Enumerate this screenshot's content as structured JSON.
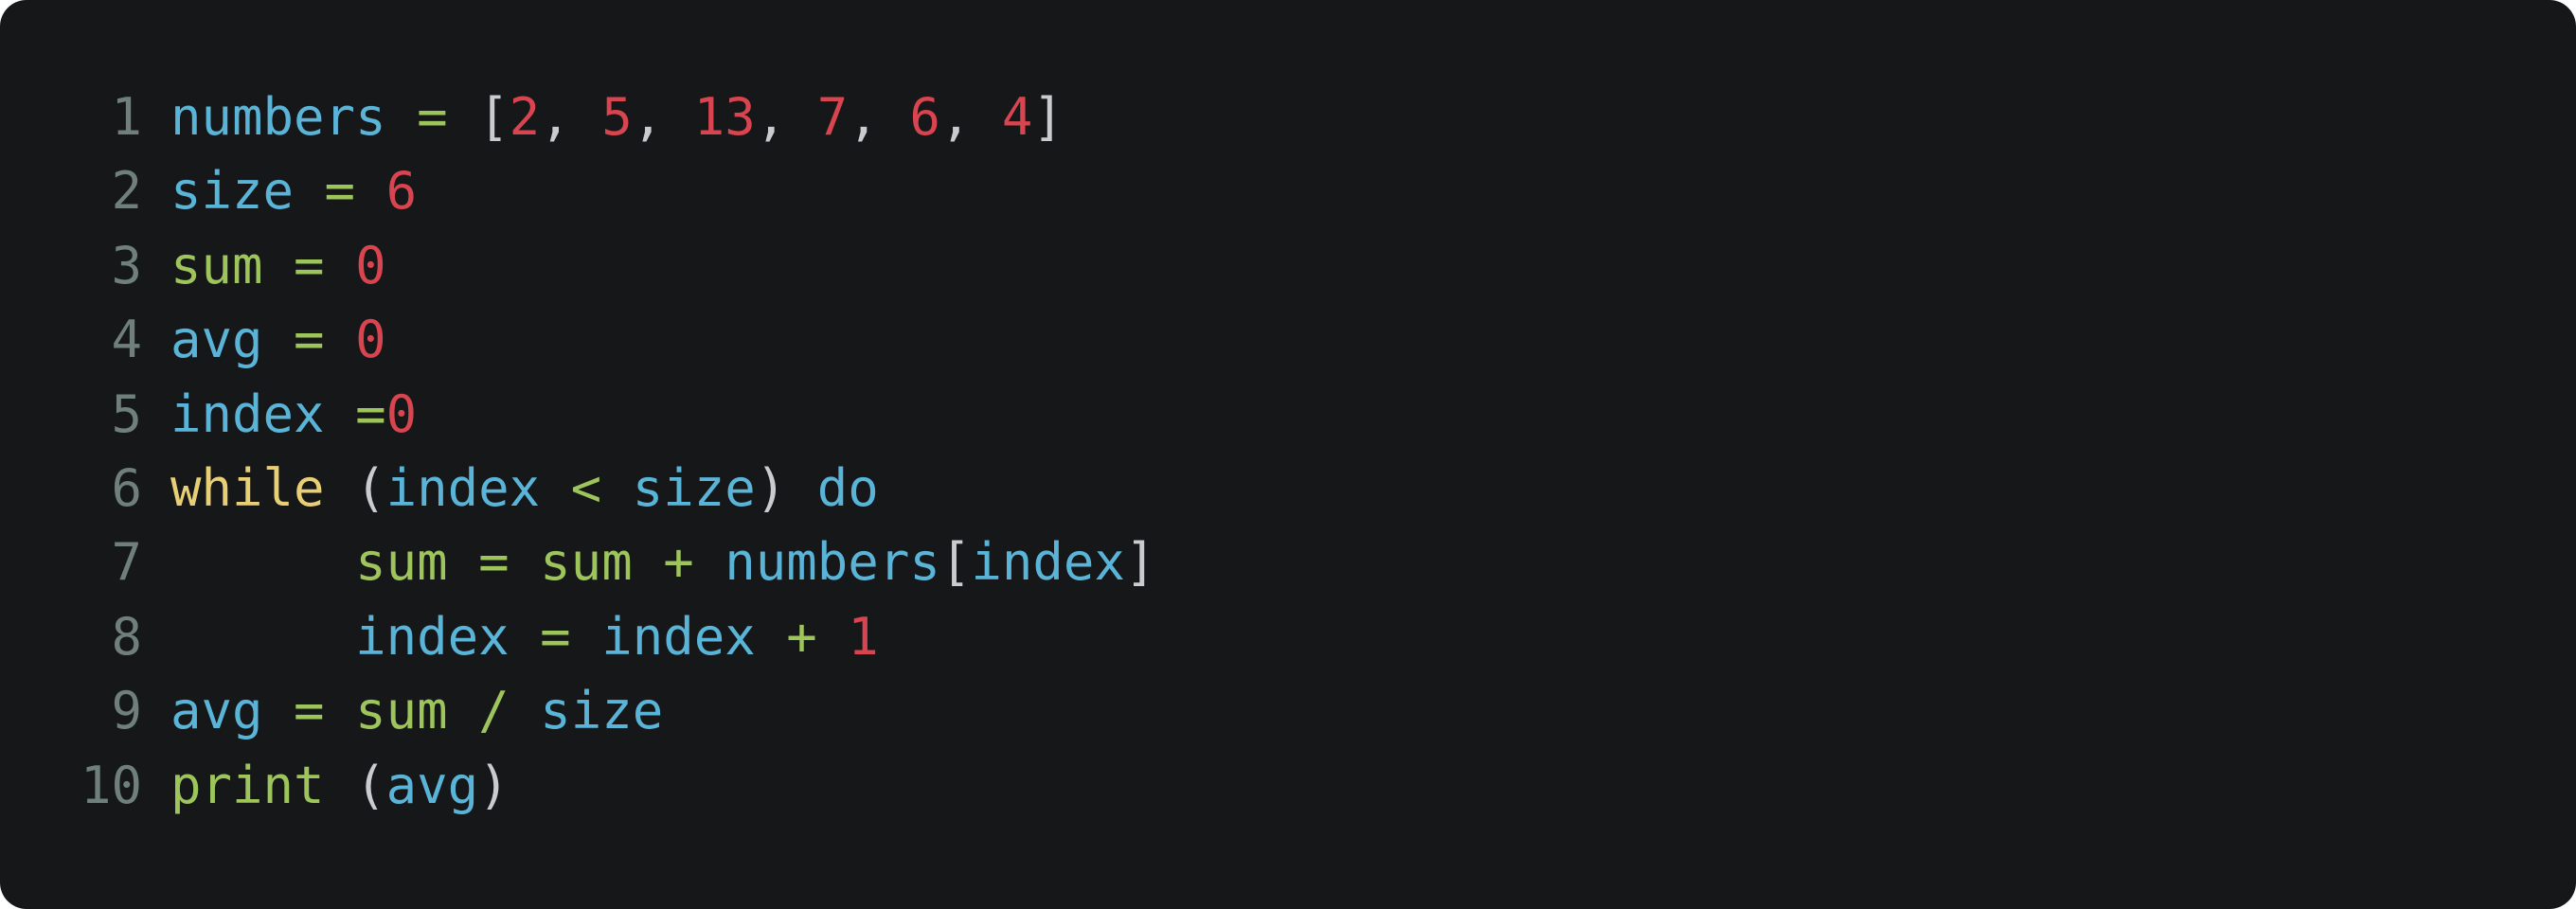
{
  "colors": {
    "background": "#151719",
    "line_number": "#6f7f7a",
    "identifier_blue": "#5ab4d8",
    "identifier_green": "#9ec45c",
    "number_red": "#d8444f",
    "keyword_yellow": "#e8cf76",
    "punctuation": "#c9cccf"
  },
  "lines": [
    {
      "number": "1",
      "tokens": [
        {
          "text": "numbers",
          "color": "#5ab4d8"
        },
        {
          "text": " = ",
          "color": "#9ec45c"
        },
        {
          "text": "[",
          "color": "#c9cccf"
        },
        {
          "text": "2",
          "color": "#d8444f"
        },
        {
          "text": ", ",
          "color": "#c9cccf"
        },
        {
          "text": "5",
          "color": "#d8444f"
        },
        {
          "text": ", ",
          "color": "#c9cccf"
        },
        {
          "text": "13",
          "color": "#d8444f"
        },
        {
          "text": ", ",
          "color": "#c9cccf"
        },
        {
          "text": "7",
          "color": "#d8444f"
        },
        {
          "text": ", ",
          "color": "#c9cccf"
        },
        {
          "text": "6",
          "color": "#d8444f"
        },
        {
          "text": ", ",
          "color": "#c9cccf"
        },
        {
          "text": "4",
          "color": "#d8444f"
        },
        {
          "text": "]",
          "color": "#c9cccf"
        }
      ]
    },
    {
      "number": "2",
      "tokens": [
        {
          "text": "size",
          "color": "#5ab4d8"
        },
        {
          "text": " = ",
          "color": "#9ec45c"
        },
        {
          "text": "6",
          "color": "#d8444f"
        }
      ]
    },
    {
      "number": "3",
      "tokens": [
        {
          "text": "sum",
          "color": "#9ec45c"
        },
        {
          "text": " = ",
          "color": "#9ec45c"
        },
        {
          "text": "0",
          "color": "#d8444f"
        }
      ]
    },
    {
      "number": "4",
      "tokens": [
        {
          "text": "avg",
          "color": "#5ab4d8"
        },
        {
          "text": " = ",
          "color": "#9ec45c"
        },
        {
          "text": "0",
          "color": "#d8444f"
        }
      ]
    },
    {
      "number": "5",
      "tokens": [
        {
          "text": "index",
          "color": "#5ab4d8"
        },
        {
          "text": " =",
          "color": "#9ec45c"
        },
        {
          "text": "0",
          "color": "#d8444f"
        }
      ]
    },
    {
      "number": "6",
      "tokens": [
        {
          "text": "while",
          "color": "#e8cf76"
        },
        {
          "text": " (",
          "color": "#c9cccf"
        },
        {
          "text": "index",
          "color": "#5ab4d8"
        },
        {
          "text": " < ",
          "color": "#9ec45c"
        },
        {
          "text": "size",
          "color": "#5ab4d8"
        },
        {
          "text": ") ",
          "color": "#c9cccf"
        },
        {
          "text": "do",
          "color": "#5ab4d8"
        }
      ]
    },
    {
      "number": "7",
      "tokens": [
        {
          "text": "      ",
          "color": "#c9cccf"
        },
        {
          "text": "sum",
          "color": "#9ec45c"
        },
        {
          "text": " = ",
          "color": "#9ec45c"
        },
        {
          "text": "sum",
          "color": "#9ec45c"
        },
        {
          "text": " + ",
          "color": "#9ec45c"
        },
        {
          "text": "numbers",
          "color": "#5ab4d8"
        },
        {
          "text": "[",
          "color": "#c9cccf"
        },
        {
          "text": "index",
          "color": "#5ab4d8"
        },
        {
          "text": "]",
          "color": "#c9cccf"
        }
      ]
    },
    {
      "number": "8",
      "tokens": [
        {
          "text": "      ",
          "color": "#c9cccf"
        },
        {
          "text": "index",
          "color": "#5ab4d8"
        },
        {
          "text": " = ",
          "color": "#9ec45c"
        },
        {
          "text": "index",
          "color": "#5ab4d8"
        },
        {
          "text": " + ",
          "color": "#9ec45c"
        },
        {
          "text": "1",
          "color": "#d8444f"
        }
      ]
    },
    {
      "number": "9",
      "tokens": [
        {
          "text": "avg",
          "color": "#5ab4d8"
        },
        {
          "text": " = ",
          "color": "#9ec45c"
        },
        {
          "text": "sum",
          "color": "#9ec45c"
        },
        {
          "text": " / ",
          "color": "#9ec45c"
        },
        {
          "text": "size",
          "color": "#5ab4d8"
        }
      ]
    },
    {
      "number": "10",
      "tokens": [
        {
          "text": "print",
          "color": "#9ec45c"
        },
        {
          "text": " (",
          "color": "#c9cccf"
        },
        {
          "text": "avg",
          "color": "#5ab4d8"
        },
        {
          "text": ")",
          "color": "#c9cccf"
        }
      ]
    }
  ]
}
